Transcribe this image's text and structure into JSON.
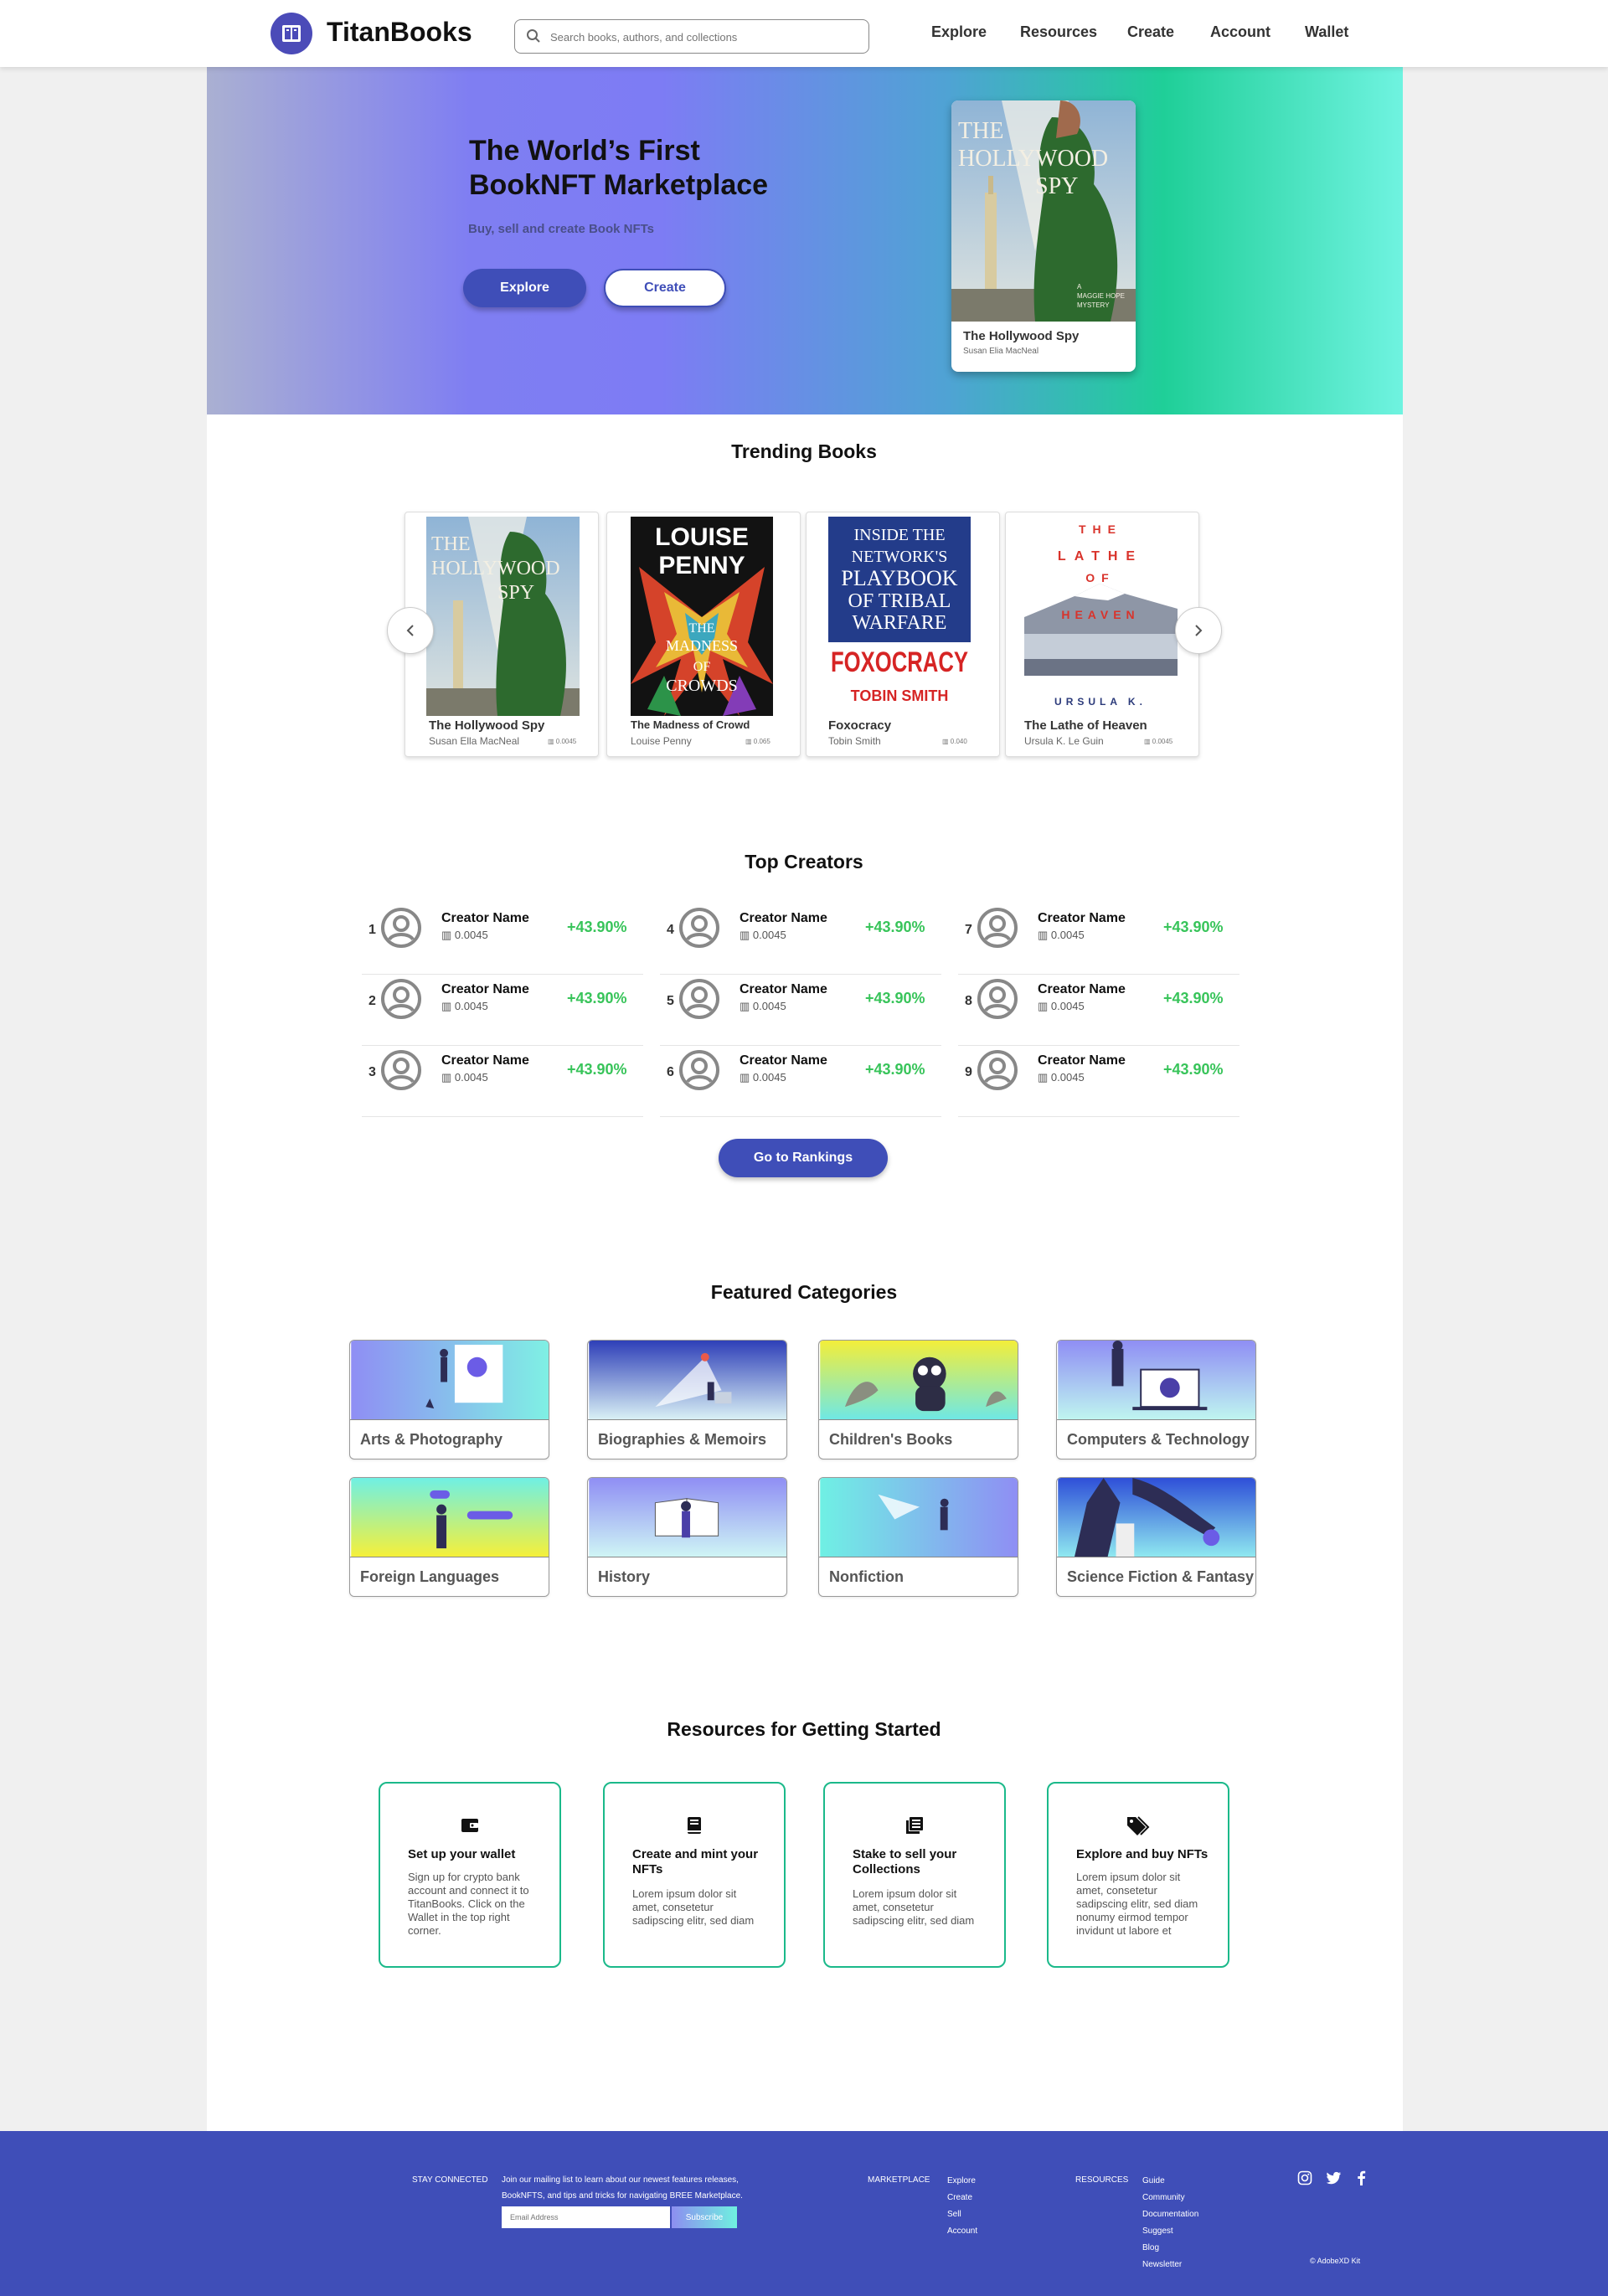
{
  "header": {
    "logo_text": "TitanBooks",
    "search_placeholder": "Search books, authors, and collections",
    "nav": [
      "Explore",
      "Resources",
      "Create",
      "Account",
      "Wallet"
    ]
  },
  "hero": {
    "title_line1": "The World’s First",
    "title_line2": "BookNFT Marketplace",
    "subtitle": "Buy, sell and create Book NFTs",
    "explore_label": "Explore",
    "create_label": "Create",
    "card": {
      "cover_lines": [
        "THE",
        "HOLLYWOOD",
        "SPY"
      ],
      "cover_tag": [
        "A",
        "MAGGIE HOPE",
        "MYSTERY"
      ],
      "title": "The Hollywood Spy",
      "author": "Susan Elia MacNeal"
    }
  },
  "trending": {
    "title": "Trending Books",
    "books": [
      {
        "title": "The Hollywood Spy",
        "author": "Susan Ella MacNeal",
        "price": "0.0045",
        "cover": [
          "THE",
          "HOLLYWOOD",
          "SPY"
        ]
      },
      {
        "title": "The Madness of Crowd",
        "author": "Louise Penny",
        "price": "0.065",
        "cover": [
          "LOUISE",
          "PENNY",
          "THE",
          "MADNESS",
          "OF",
          "CROWDS"
        ]
      },
      {
        "title": "Foxocracy",
        "author": "Tobin Smith",
        "price": "0.040",
        "cover": [
          "INSIDE THE",
          "NETWORK'S",
          "PLAYBOOK",
          "OF TRIBAL",
          "WARFARE",
          "FOXOCRACY",
          "TOBIN SMITH"
        ]
      },
      {
        "title": "The Lathe of Heaven",
        "author": "Ursula K. Le Guin",
        "price": "0.0045",
        "cover": [
          "THE",
          "LATHE",
          "OF",
          "HEAVEN",
          "URSULA K."
        ]
      }
    ]
  },
  "creators": {
    "title": "Top Creators",
    "items": [
      {
        "rank": "1",
        "name": "Creator Name",
        "value": "0.0045",
        "change": "+43.90%"
      },
      {
        "rank": "2",
        "name": "Creator Name",
        "value": "0.0045",
        "change": "+43.90%"
      },
      {
        "rank": "3",
        "name": "Creator Name",
        "value": "0.0045",
        "change": "+43.90%"
      },
      {
        "rank": "4",
        "name": "Creator Name",
        "value": "0.0045",
        "change": "+43.90%"
      },
      {
        "rank": "5",
        "name": "Creator Name",
        "value": "0.0045",
        "change": "+43.90%"
      },
      {
        "rank": "6",
        "name": "Creator Name",
        "value": "0.0045",
        "change": "+43.90%"
      },
      {
        "rank": "7",
        "name": "Creator Name",
        "value": "0.0045",
        "change": "+43.90%"
      },
      {
        "rank": "8",
        "name": "Creator Name",
        "value": "0.0045",
        "change": "+43.90%"
      },
      {
        "rank": "9",
        "name": "Creator Name",
        "value": "0.0045",
        "change": "+43.90%"
      }
    ],
    "button_label": "Go to Rankings"
  },
  "categories": {
    "title": "Featured Categories",
    "items": [
      "Arts & Photography",
      "Biographies & Memoirs",
      "Children's Books",
      "Computers & Technology",
      "Foreign Languages",
      "History",
      "Nonfiction",
      "Science Fiction & Fantasy"
    ]
  },
  "resources": {
    "title": "Resources for Getting Started",
    "items": [
      {
        "title": "Set up your wallet",
        "desc": "Sign up for crypto bank account and connect it to TitanBooks. Click on the Wallet in the top right corner.",
        "icon": "wallet-icon"
      },
      {
        "title": "Create and mint your NFTs",
        "desc": "Lorem ipsum dolor sit amet, consetetur sadipscing elitr, sed diam",
        "icon": "book-icon"
      },
      {
        "title": "Stake to sell your Collections",
        "desc": "Lorem ipsum dolor sit amet, consetetur sadipscing elitr, sed diam",
        "icon": "collection-icon"
      },
      {
        "title": "Explore and buy NFTs",
        "desc": "Lorem ipsum dolor sit amet, consetetur sadipscing elitr, sed diam nonumy eirmod tempor invidunt ut labore et",
        "icon": "tags-icon"
      }
    ]
  },
  "footer": {
    "stay_connected": "STAY CONNECTED",
    "mailing_line1": "Join our mailing list to learn about our newest features releases,",
    "mailing_line2": "BookNFTS, and tips and tricks for navigating BREE Marketplace.",
    "email_placeholder": "Email Address",
    "subscribe_label": "Subscribe",
    "marketplace_heading": "MARKETPLACE",
    "marketplace_links": [
      "Explore",
      "Create",
      "Sell",
      "Account"
    ],
    "resources_heading": "RESOURCES",
    "resources_links": [
      "Guide",
      "Community",
      "Documentation",
      "Suggest",
      "Blog",
      "Newsletter"
    ],
    "copyright": "© AdobeXD Kit"
  },
  "colors": {
    "brand": "#3f4eb8",
    "positive": "#38c45a",
    "resource_border": "#1bb98a"
  }
}
